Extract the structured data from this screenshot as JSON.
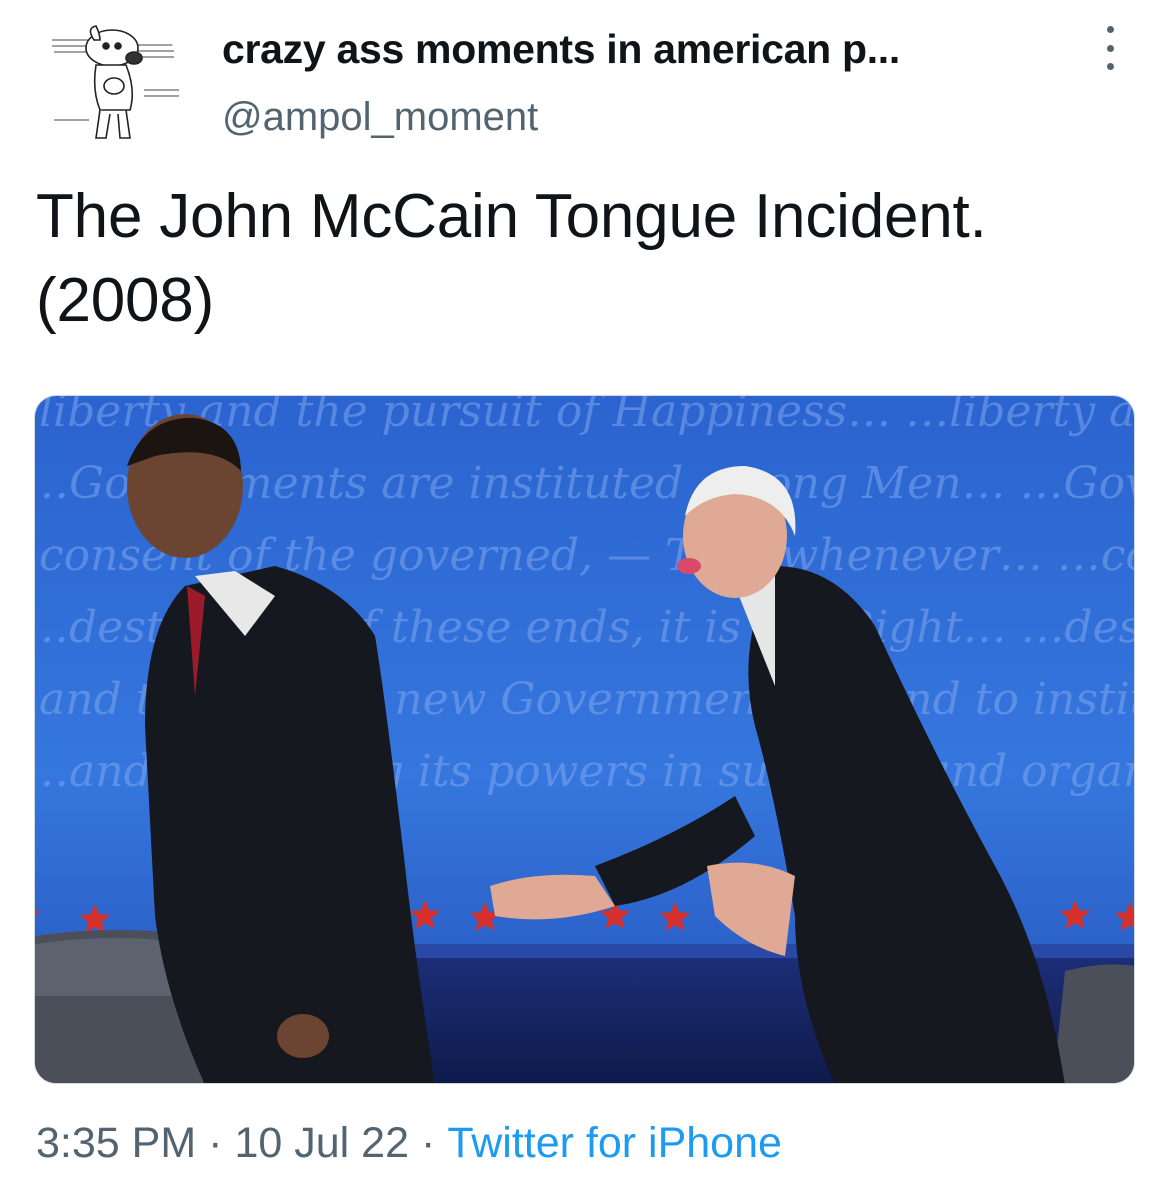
{
  "author": {
    "display_name": "crazy ass moments in american p...",
    "handle": "@ampol_moment",
    "avatar_icon": "cartoon-dog-avatar"
  },
  "more_icon": "more-vertical-icon",
  "tweet": {
    "text_line1": "The John McCain Tongue Incident.",
    "text_line2": "(2008)"
  },
  "media": {
    "background_text_rows": [
      "…liberty and the pursuit of Happiness…",
      "…Governments are instituted among Men…",
      "…consent of the governed, — That whenever…",
      "…destructive of these ends, it is the Right…",
      "…and to institute new Government…",
      "…and organizing its powers in such…"
    ],
    "colors": {
      "stage_blue": "#2f6fd6",
      "stage_dark": "#1f3f8c",
      "star_red": "#d6302d"
    }
  },
  "footer": {
    "time": "3:35 PM",
    "date": "10 Jul 22",
    "separator": "·",
    "source": "Twitter for iPhone"
  }
}
